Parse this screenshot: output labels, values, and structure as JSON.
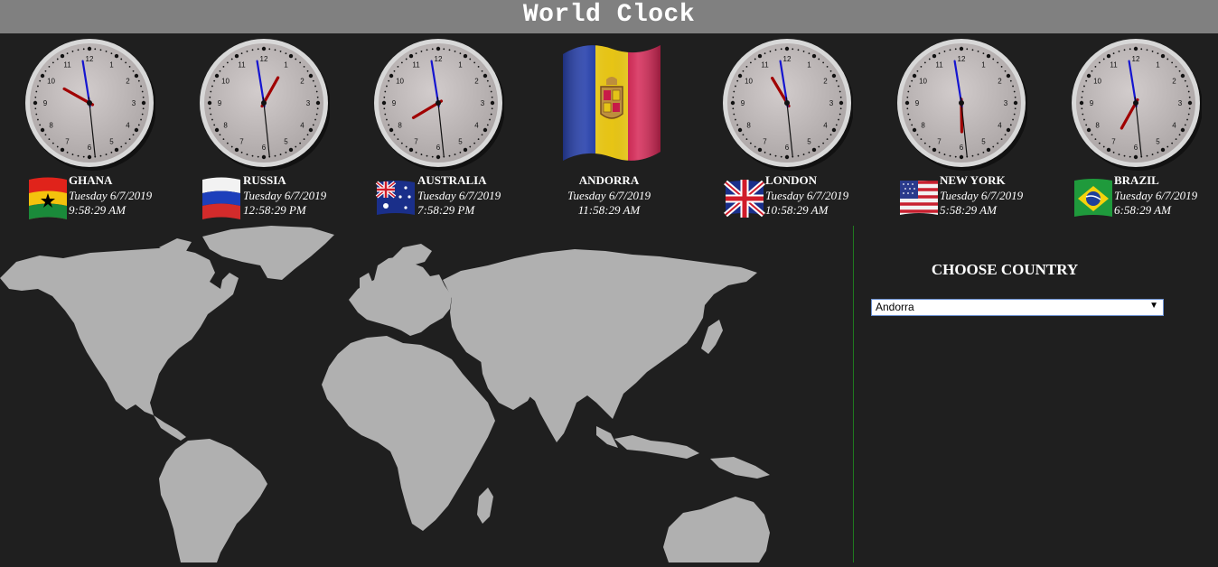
{
  "page": {
    "title": "World Clock"
  },
  "clocks": [
    {
      "id": "ghana",
      "name": "GHANA",
      "date": "Tuesday 6/7/2019",
      "time": "9:58:29 AM",
      "hour": 9,
      "minute": 58,
      "second": 29,
      "flag": "ghana"
    },
    {
      "id": "russia",
      "name": "RUSSIA",
      "date": "Tuesday 6/7/2019",
      "time": "12:58:29 PM",
      "hour": 12,
      "minute": 58,
      "second": 29,
      "flag": "russia"
    },
    {
      "id": "australia",
      "name": "AUSTRALIA",
      "date": "Tuesday 6/7/2019",
      "time": "7:58:29 PM",
      "hour": 7,
      "minute": 58,
      "second": 29,
      "flag": "australia"
    },
    {
      "id": "andorra",
      "name": "ANDORRA",
      "date": "Tuesday 6/7/2019",
      "time": "11:58:29 AM",
      "flag": "andorra"
    },
    {
      "id": "london",
      "name": "LONDON",
      "date": "Tuesday 6/7/2019",
      "time": "10:58:29 AM",
      "hour": 10,
      "minute": 58,
      "second": 29,
      "flag": "uk"
    },
    {
      "id": "new-york",
      "name": "NEW YORK",
      "date": "Tuesday 6/7/2019",
      "time": "5:58:29 AM",
      "hour": 5,
      "minute": 58,
      "second": 29,
      "flag": "usa"
    },
    {
      "id": "brazil",
      "name": "BRAZIL",
      "date": "Tuesday 6/7/2019",
      "time": "6:58:29 AM",
      "hour": 6,
      "minute": 58,
      "second": 29,
      "flag": "brazil"
    }
  ],
  "clock_numbers": [
    "12",
    "1",
    "2",
    "3",
    "4",
    "5",
    "6",
    "7",
    "8",
    "9",
    "10",
    "11"
  ],
  "sidebar": {
    "heading": "CHOOSE COUNTRY",
    "selected_country": "Andorra"
  },
  "colors": {
    "background": "#1f1f1f",
    "header": "#808080",
    "map_land": "#b0b0b0",
    "hour_hand": "#a00000",
    "minute_hand": "#1515d0",
    "divider": "#1f7a1f"
  }
}
